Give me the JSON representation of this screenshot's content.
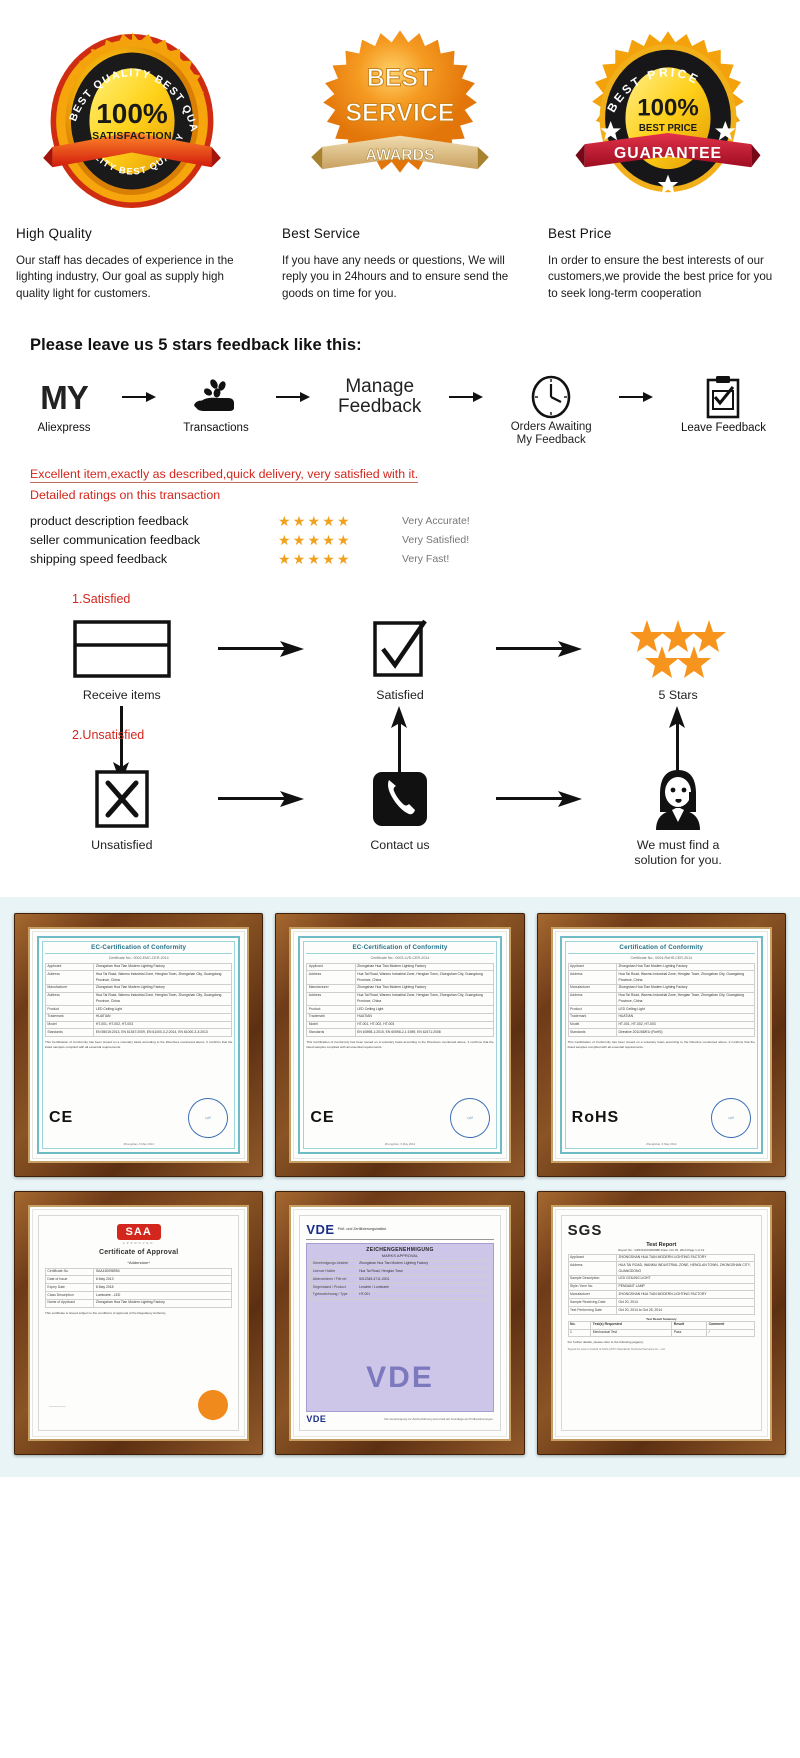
{
  "badges": {
    "items": [
      {
        "seal_name": "best-quality-seal",
        "seal_top": "BEST QUALITY",
        "seal_main": "100%",
        "seal_sub": "SATISFACTION",
        "seal_ribbon": "",
        "title": "High Quality",
        "desc": "Our staff has decades of experience in the lighting industry, Our goal as supply high quality light for customers."
      },
      {
        "seal_name": "best-service-seal",
        "seal_top": "BEST",
        "seal_main": "SERVICE",
        "seal_sub": "",
        "seal_ribbon": "AWARDS",
        "title": "Best Service",
        "desc": "If you have any needs or questions, We will reply you in 24hours and to ensure send the goods on time for you."
      },
      {
        "seal_name": "best-price-seal",
        "seal_top": "BEST PRICE",
        "seal_main": "100%",
        "seal_sub": "BEST PRICE",
        "seal_ribbon": "GUARANTEE",
        "title": "Best Price",
        "desc": "In order to ensure the best interests of our customers,we provide the best price for you to seek long-term cooperation"
      }
    ]
  },
  "feedback": {
    "heading": "Please leave us 5 stars feedback like this:",
    "flow": [
      {
        "icon": "my-aliexpress-icon",
        "word": "MY",
        "caption": "Aliexpress"
      },
      {
        "icon": "hand-coins-icon",
        "word": "",
        "caption": "Transactions"
      },
      {
        "icon": "manage-feedback-text-icon",
        "word": "Manage\nFeedback",
        "caption": ""
      },
      {
        "icon": "clock-icon",
        "word": "",
        "caption": "Orders Awaiting\nMy Feedback"
      },
      {
        "icon": "clipboard-check-icon",
        "word": "",
        "caption": "Leave Feedback"
      }
    ],
    "review_line1": "Excellent item,exactly as described,quick delivery, very satisfied with it.",
    "review_line2": "Detailed ratings on this transaction",
    "ratings": [
      {
        "label": "product description feedback",
        "stars": "★★★★★",
        "value": "Very Accurate!"
      },
      {
        "label": "seller communication feedback",
        "stars": "★★★★★",
        "value": "Very Satisfied!"
      },
      {
        "label": "shipping speed feedback",
        "stars": "★★★★★",
        "value": "Very Fast!"
      }
    ],
    "satisfied_step_label": "1.Satisfied",
    "unsatisfied_step_label": "2.Unsatisfied",
    "satisfied_flow": [
      {
        "icon": "package-box-icon",
        "caption": "Receive items"
      },
      {
        "icon": "checkmark-box-icon",
        "caption": "Satisfied"
      },
      {
        "icon": "five-stars-icon",
        "caption": "5 Stars"
      }
    ],
    "unsatisfied_flow": [
      {
        "icon": "x-box-icon",
        "caption": "Unsatisfied"
      },
      {
        "icon": "phone-icon",
        "caption": "Contact us"
      },
      {
        "icon": "support-agent-icon",
        "caption": "We must find a solution for you."
      }
    ]
  },
  "certificates": [
    {
      "name": "ce-certificate-1",
      "style": "teal",
      "title": "EC-Certification of Conformity",
      "subtitle": "Certificate No.: 0002-EMC-CER-2014",
      "rows": [
        [
          "Applicant",
          "Zhongshan Hua Tian Modern Lighting Factory"
        ],
        [
          "Address",
          "Hua Tai Road, Wanmu Industrial Zone, Henglan Town, Zhongshan City, Guangdong Province, China"
        ],
        [
          "Manufacturer",
          "Zhongshan Hua Tian Modern Lighting Factory"
        ],
        [
          "Address",
          "Hua Tai Road, Wanmu Industrial Zone, Henglan Town, Zhongshan City, Guangdong Province, China"
        ],
        [
          "Product",
          "LED Ceiling Light"
        ],
        [
          "Trademark",
          "HUATIAN"
        ],
        [
          "Model",
          "HT-001, HT-002, HT-003"
        ],
        [
          "Standards",
          "EN 55015:2013, EN 61547:2009, EN 61000-3-2:2014, EN 61000-3-3:2013"
        ]
      ],
      "mark": "CE",
      "footnote": "This Certification of Conformity has been issued on a voluntary basis according to the Directives mentioned above. It confirms that the listed samples complied with all essential requirements.",
      "issue_line": "Zhongshan, 6 May 2014"
    },
    {
      "name": "ce-certificate-2",
      "style": "teal",
      "title": "EC-Certification of Conformity",
      "subtitle": "Certificate No.: 0003-LVD-CER-2014",
      "rows": [
        [
          "Applicant",
          "Zhongshan Hua Tian Modern Lighting Factory"
        ],
        [
          "Address",
          "Hua Tai Road, Wanmu Industrial Zone, Henglan Town, Zhongshan City, Guangdong Province, China"
        ],
        [
          "Manufacturer",
          "Zhongshan Hua Tian Modern Lighting Factory"
        ],
        [
          "Address",
          "Hua Tai Road, Wanmu Industrial Zone, Henglan Town, Zhongshan City, Guangdong Province, China"
        ],
        [
          "Product",
          "LED Ceiling Light"
        ],
        [
          "Trademark",
          "HUATIAN"
        ],
        [
          "Model",
          "HT-001, HT-002, HT-003"
        ],
        [
          "Standards",
          "EN 60598-1:2015, EN 60598-2-1:1989, EN 62471:2008"
        ]
      ],
      "mark": "CE",
      "footnote": "This Certification of Conformity has been issued on a voluntary basis according to the Directives mentioned above. It confirms that the listed samples complied with all essential requirements.",
      "issue_line": "Zhongshan, 6 May 2014"
    },
    {
      "name": "rohs-certificate",
      "style": "teal",
      "title": "Certification of Conformity",
      "subtitle": "Certificate No.: 0004-RoHS-CER-2014",
      "rows": [
        [
          "Applicant",
          "Zhongshan Hua Tian Modern Lighting Factory"
        ],
        [
          "Address",
          "Hua Tai Road, Wanmu Industrial Zone, Henglan Town, Zhongshan City, Guangdong Province, China"
        ],
        [
          "Manufacturer",
          "Zhongshan Hua Tian Modern Lighting Factory"
        ],
        [
          "Address",
          "Hua Tai Road, Wanmu Industrial Zone, Henglan Town, Zhongshan City, Guangdong Province, China"
        ],
        [
          "Product",
          "LED Ceiling Light"
        ],
        [
          "Trademark",
          "HUATIAN"
        ],
        [
          "Model",
          "HT-001, HT-002, HT-003"
        ],
        [
          "Standards",
          "Directive 2011/65/EU (RoHS)"
        ]
      ],
      "mark": "RoHS",
      "footnote": "This Certification of Conformity has been issued on a voluntary basis according to the Directive mentioned above. It confirms that the listed samples complied with all essential requirements.",
      "issue_line": "Zhongshan, 6 May 2014"
    },
    {
      "name": "saa-certificate",
      "style": "plain",
      "logo": "SAA",
      "logo_sub": "APPROVED",
      "title": "Certificate of Approval",
      "subtitle": "*Addendum*",
      "rows": [
        [
          "Certificate No.",
          "SAA130098954"
        ],
        [
          "Date of Issue",
          "6 May 2013"
        ],
        [
          "Expiry Date",
          "6 May 2018"
        ],
        [
          "Class Description",
          "Luminaire - LED"
        ],
        [
          "Name of Applicant",
          "Zhongshan Hua Tian Modern Lighting Factory"
        ]
      ],
      "mark": "",
      "footnote": "This certificate is issued subject to the conditions of approval of the Regulatory Authority.",
      "issue_line": ""
    },
    {
      "name": "vde-certificate",
      "style": "plain",
      "logo": "VDE",
      "logo_sub": "Prüf- und Zertifizierungsinstitut",
      "title": "ZEICHENGENEHMIGUNG",
      "subtitle": "MARKS APPROVAL",
      "rows": [
        [
          "Genehmigungs-Inhaber",
          "Zhongshan Hua Tian Modern Lighting Factory"
        ],
        [
          "Licence Holder",
          "Hua Tai Road, Henglan Town"
        ],
        [
          "Aktenzeichen / File ref.",
          "5012345-4711-0001"
        ],
        [
          "Gegenstand / Product",
          "Leuchte / Luminaire"
        ],
        [
          "Typbezeichnung / Type",
          "HT-001"
        ]
      ],
      "mark": "VDE",
      "footnote": "Die Genehmigung zur Zeichenführung wird erteilt auf Grundlage der Prüfbestimmungen.",
      "issue_line": ""
    },
    {
      "name": "sgs-certificate",
      "style": "plain",
      "logo": "SGS",
      "logo_sub": "",
      "title": "Test Report",
      "subtitle": "Report No.: GZIN1310400098D     Date: Oct 25, 2014     Page 1 of 12",
      "rows": [
        [
          "Applicant",
          "ZHONGSHAN HUA TIAN MODERN LIGHTING FACTORY"
        ],
        [
          "Address",
          "HUA TAI ROAD, WANMU INDUSTRIAL ZONE, HENGLAN TOWN, ZHONGSHAN CITY, GUANGDONG"
        ],
        [
          "Sample Description",
          "LED CEILING LIGHT"
        ],
        [
          "Style / Item No.",
          "PENDANT LAMP"
        ],
        [
          "Manufacturer",
          "ZHONGSHAN HUA TIAN MODERN LIGHTING FACTORY"
        ],
        [
          "Sample Receiving Date",
          "Oct 20, 2014"
        ],
        [
          "Test Performing Date",
          "Oct 20, 2014 to Oct 25, 2014"
        ]
      ],
      "result_header": [
        "No.",
        "Test(s) Requested",
        "Result",
        "Comment"
      ],
      "result_rows": [
        [
          "1",
          "Mechanical Test",
          "Pass",
          "/"
        ]
      ],
      "mark": "",
      "footnote": "For further details, please refer to the following page(s).",
      "issue_line": "Signed for and on behalf of SGS-CSTC Standards Technical Services Co., Ltd."
    }
  ]
}
